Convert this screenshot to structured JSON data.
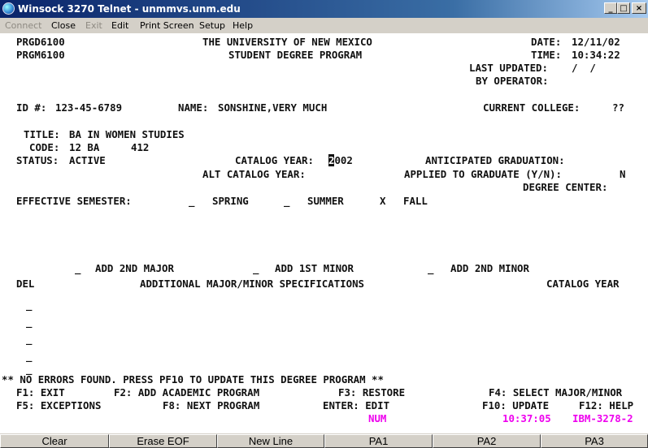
{
  "window": {
    "title": "Winsock 3270 Telnet - unmmvs.unm.edu",
    "buttons": {
      "minimize": "_",
      "maximize": "□",
      "close": "×"
    }
  },
  "menu": [
    {
      "label": "Connect",
      "enabled": false
    },
    {
      "label": "Close",
      "enabled": true
    },
    {
      "label": "Exit",
      "enabled": false
    },
    {
      "label": "Edit",
      "enabled": true
    },
    {
      "label": "Print Screen",
      "enabled": true
    },
    {
      "label": "Setup",
      "enabled": true
    },
    {
      "label": "Help",
      "enabled": true
    }
  ],
  "screen": {
    "program_id_1": "PRGD6100",
    "program_id_2": "PRGM6100",
    "university": "THE UNIVERSITY OF NEW MEXICO",
    "program_name": "STUDENT DEGREE PROGRAM",
    "date_label": "DATE:",
    "date_value": "12/11/02",
    "time_label": "TIME:",
    "time_value": "10:34:22",
    "last_updated_label": "LAST UPDATED:",
    "last_updated_value": "/  /",
    "by_operator_label": "BY OPERATOR:",
    "id_label": "ID #:",
    "id_value": "123-45-6789",
    "name_label": "NAME:",
    "name_value": "SONSHINE,VERY MUCH",
    "current_college_label": "CURRENT COLLEGE:",
    "current_college_value": "??",
    "title_label": "TITLE:",
    "title_value": "BA IN WOMEN STUDIES",
    "code_label": "CODE:",
    "code_value": "12 BA",
    "code_extra": "412",
    "status_label": "STATUS:",
    "status_value": "ACTIVE",
    "catalog_year_label": "CATALOG YEAR:",
    "catalog_year_cursor": "2",
    "catalog_year_rest": "002",
    "anticipated_graduation_label": "ANTICIPATED GRADUATION:",
    "alt_catalog_year_label": "ALT CATALOG YEAR:",
    "applied_to_graduate_label": "APPLIED TO GRADUATE (Y/N):",
    "applied_to_graduate_value": "N",
    "degree_center_label": "DEGREE CENTER:",
    "effective_semester_label": "EFFECTIVE SEMESTER:",
    "semester_spring_mark": "_",
    "semester_spring": "SPRING",
    "semester_summer_mark": "_",
    "semester_summer": "SUMMER",
    "semester_fall_mark": "X",
    "semester_fall": "FALL",
    "add_2nd_major_mark": "_",
    "add_2nd_major": "ADD 2ND MAJOR",
    "add_1st_minor_mark": "_",
    "add_1st_minor": "ADD 1ST MINOR",
    "add_2nd_minor_mark": "_",
    "add_2nd_minor": "ADD 2ND MINOR",
    "col_del": "DEL",
    "col_specs": "ADDITIONAL MAJOR/MINOR SPECIFICATIONS",
    "col_catalog_year": "CATALOG YEAR",
    "del_rows": [
      "_",
      "_",
      "_",
      "_",
      "_"
    ],
    "message": "** NO ERRORS FOUND. PRESS PF10 TO UPDATE THIS DEGREE PROGRAM **",
    "pf1": "F1: EXIT",
    "pf2": "F2: ADD ACADEMIC PROGRAM",
    "pf3": "F3: RESTORE",
    "pf4": "F4: SELECT MAJOR/MINOR",
    "pf5": "F5: EXCEPTIONS",
    "pf8": "F8: NEXT PROGRAM",
    "enter": "ENTER: EDIT",
    "pf10": "F10: UPDATE",
    "pf12": "F12: HELP"
  },
  "status_line": {
    "num": "NUM",
    "clock": "10:37:05",
    "terminal_type": "IBM-3278-2"
  },
  "pa_keys": [
    "Clear",
    "Erase EOF",
    "New Line",
    "PA1",
    "PA2",
    "PA3"
  ],
  "colors": {
    "titlebar_start": "#0a246a",
    "titlebar_end": "#a6caf0",
    "terminal_text": "#101010",
    "status_magenta": "#ee00ee",
    "chrome_gray": "#d4d0c8"
  }
}
